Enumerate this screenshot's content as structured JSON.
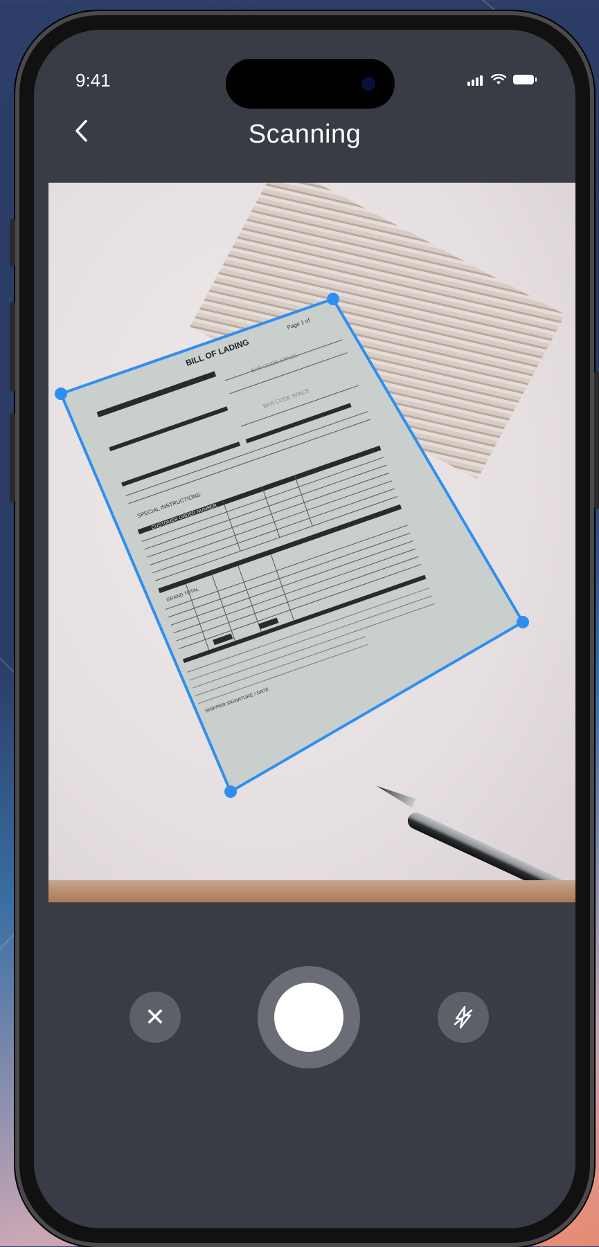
{
  "background": {
    "script_text": "",
    "side_text": ""
  },
  "status_bar": {
    "time": "9:41"
  },
  "nav": {
    "back_icon": "chevron-left-icon",
    "back_glyph": "‹",
    "title": "Scanning"
  },
  "document": {
    "title": "BILL OF LADING",
    "page": "Page 1 of",
    "bar_code_1": "BAR CODE SPACE",
    "bar_code_2": "BAR CODE SPACE",
    "special_instructions": "SPECIAL INSTRUCTIONS:",
    "customer_order": "CUSTOMER ORDER NUMBER",
    "grand_total": "GRAND TOTAL",
    "signature": "SHIPPER SIGNATURE / DATE"
  },
  "controls": {
    "cancel_icon": "close-icon",
    "cancel_glyph": "✕",
    "shutter_icon": "shutter-button-icon",
    "flash_icon": "flash-off-icon"
  },
  "colors": {
    "accent": "#2f8ff0",
    "screen_bg": "#393b45"
  }
}
